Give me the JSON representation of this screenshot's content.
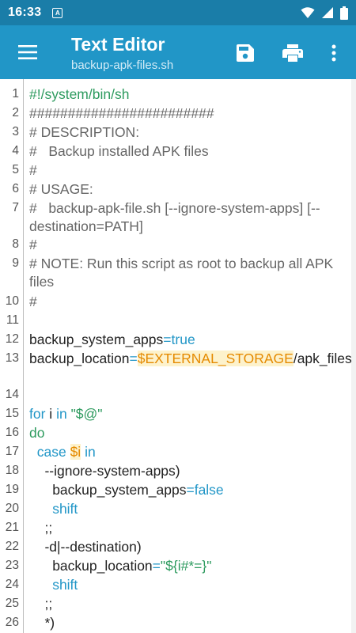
{
  "status_bar": {
    "time": "16:33",
    "notification_icon_letter": "A",
    "icons": [
      "wifi-icon",
      "signal-icon",
      "battery-icon"
    ]
  },
  "app_bar": {
    "title": "Text Editor",
    "subtitle": "backup-apk-files.sh",
    "icons": [
      "menu-icon",
      "save-icon",
      "print-icon",
      "more-vert-icon"
    ]
  },
  "colors": {
    "status_bar": "#1a7da8",
    "app_bar": "#2196c7",
    "comment": "#666666",
    "plain": "#222222",
    "keyword": "#2196c7",
    "string": "#2e9b5f",
    "variable": "#e58a00",
    "variable_highlight": "#fdf2cc",
    "line_number": "#555555"
  },
  "editor": {
    "lines": [
      {
        "num": "1",
        "tokens": [
          {
            "t": "#!/system/bin/sh",
            "c": "shebang"
          }
        ]
      },
      {
        "num": "2",
        "tokens": [
          {
            "t": "########################",
            "c": "comment"
          }
        ]
      },
      {
        "num": "3",
        "tokens": [
          {
            "t": "# DESCRIPTION:",
            "c": "comment"
          }
        ]
      },
      {
        "num": "4",
        "tokens": [
          {
            "t": "#   Backup installed APK files",
            "c": "comment"
          }
        ]
      },
      {
        "num": "5",
        "tokens": [
          {
            "t": "#",
            "c": "comment"
          }
        ]
      },
      {
        "num": "6",
        "tokens": [
          {
            "t": "# USAGE:",
            "c": "comment"
          }
        ]
      },
      {
        "num": "7",
        "tokens": [
          {
            "t": "#   backup-apk-file.sh [--ignore-system-apps] [--destination=PATH]",
            "c": "comment"
          }
        ]
      },
      {
        "num": "8",
        "tokens": [
          {
            "t": "#",
            "c": "comment"
          }
        ]
      },
      {
        "num": "9",
        "tokens": [
          {
            "t": "# NOTE: Run this script as root to backup all APK files",
            "c": "comment"
          }
        ]
      },
      {
        "num": "10",
        "tokens": [
          {
            "t": "#",
            "c": "comment"
          }
        ]
      },
      {
        "num": "11",
        "tokens": []
      },
      {
        "num": "12",
        "tokens": [
          {
            "t": "backup_system_apps",
            "c": "plain"
          },
          {
            "t": "=",
            "c": "keyword"
          },
          {
            "t": "true",
            "c": "keyword"
          }
        ]
      },
      {
        "num": "13",
        "tokens": [
          {
            "t": "backup_location",
            "c": "plain"
          },
          {
            "t": "=",
            "c": "keyword"
          },
          {
            "t": "$EXTERNAL_STORAGE",
            "c": "variable"
          },
          {
            "t": "/apk_files",
            "c": "plain"
          }
        ]
      },
      {
        "num": "14",
        "tokens": []
      },
      {
        "num": "15",
        "tokens": [
          {
            "t": "for",
            "c": "keyword"
          },
          {
            "t": " i ",
            "c": "plain"
          },
          {
            "t": "in",
            "c": "keyword"
          },
          {
            "t": " ",
            "c": "plain"
          },
          {
            "t": "\"$@\"",
            "c": "string"
          }
        ]
      },
      {
        "num": "16",
        "tokens": [
          {
            "t": "do",
            "c": "string"
          }
        ]
      },
      {
        "num": "17",
        "tokens": [
          {
            "t": "  ",
            "c": "plain"
          },
          {
            "t": "case",
            "c": "keyword"
          },
          {
            "t": " ",
            "c": "plain"
          },
          {
            "t": "$i",
            "c": "variable"
          },
          {
            "t": " ",
            "c": "plain"
          },
          {
            "t": "in",
            "c": "keyword"
          }
        ]
      },
      {
        "num": "18",
        "tokens": [
          {
            "t": "    --ignore-system-apps",
            "c": "plain"
          },
          {
            "t": ")",
            "c": "plain"
          }
        ]
      },
      {
        "num": "19",
        "tokens": [
          {
            "t": "      backup_system_apps",
            "c": "plain"
          },
          {
            "t": "=",
            "c": "keyword"
          },
          {
            "t": "false",
            "c": "keyword"
          }
        ]
      },
      {
        "num": "20",
        "tokens": [
          {
            "t": "      ",
            "c": "plain"
          },
          {
            "t": "shift",
            "c": "keyword"
          }
        ]
      },
      {
        "num": "21",
        "tokens": [
          {
            "t": "    ;;",
            "c": "plain"
          }
        ]
      },
      {
        "num": "22",
        "tokens": [
          {
            "t": "    -d|--destination",
            "c": "plain"
          },
          {
            "t": ")",
            "c": "plain"
          }
        ]
      },
      {
        "num": "23",
        "tokens": [
          {
            "t": "      backup_location",
            "c": "plain"
          },
          {
            "t": "=",
            "c": "keyword"
          },
          {
            "t": "\"${i#*=}\"",
            "c": "string"
          }
        ]
      },
      {
        "num": "24",
        "tokens": [
          {
            "t": "      ",
            "c": "plain"
          },
          {
            "t": "shift",
            "c": "keyword"
          }
        ]
      },
      {
        "num": "25",
        "tokens": [
          {
            "t": "    ;;",
            "c": "plain"
          }
        ]
      },
      {
        "num": "26",
        "tokens": [
          {
            "t": "    *)",
            "c": "plain"
          }
        ]
      }
    ]
  }
}
